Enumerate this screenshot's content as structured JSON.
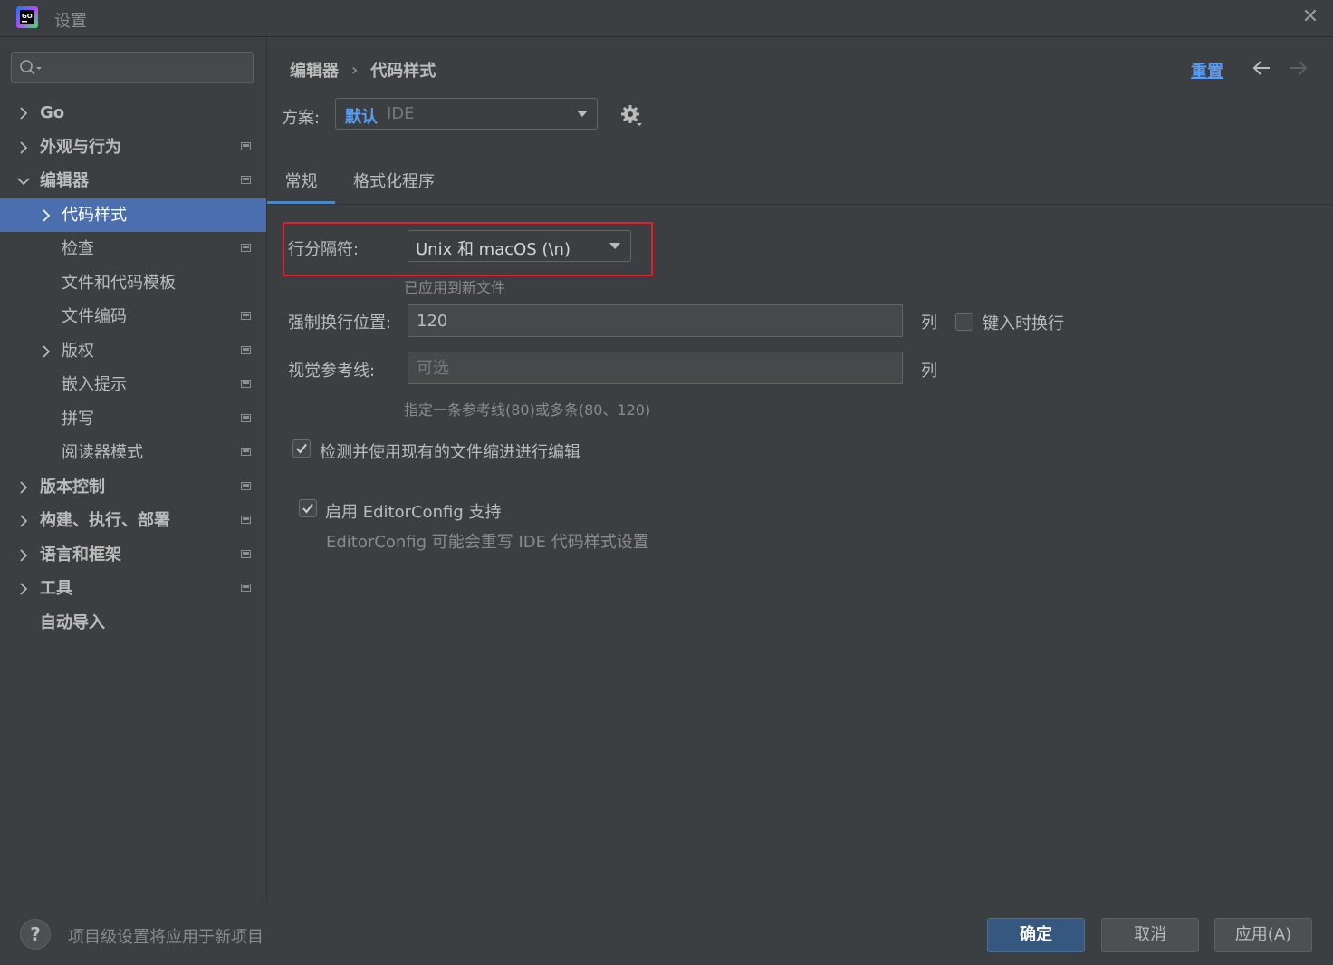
{
  "window": {
    "title": "设置"
  },
  "sidebar": {
    "search_placeholder": "",
    "items": [
      {
        "label": "Go"
      },
      {
        "label": "外观与行为"
      },
      {
        "label": "编辑器"
      },
      {
        "label": "代码样式"
      },
      {
        "label": "检查"
      },
      {
        "label": "文件和代码模板"
      },
      {
        "label": "文件编码"
      },
      {
        "label": "版权"
      },
      {
        "label": "嵌入提示"
      },
      {
        "label": "拼写"
      },
      {
        "label": "阅读器模式"
      },
      {
        "label": "版本控制"
      },
      {
        "label": "构建、执行、部署"
      },
      {
        "label": "语言和框架"
      },
      {
        "label": "工具"
      },
      {
        "label": "自动导入"
      }
    ]
  },
  "header": {
    "breadcrumb": [
      "编辑器",
      "代码样式"
    ],
    "breadcrumb_separator": "›",
    "reset_label": "重置"
  },
  "scheme": {
    "label": "方案:",
    "value_name": "默认",
    "value_type": "IDE"
  },
  "tabs": [
    {
      "label": "常规",
      "active": true
    },
    {
      "label": "格式化程序",
      "active": false
    }
  ],
  "form": {
    "line_separator": {
      "label": "行分隔符:",
      "value": "Unix 和 macOS (\\n)",
      "hint": "已应用到新文件"
    },
    "hard_wrap": {
      "label": "强制换行位置:",
      "value": "120",
      "unit": "列",
      "wrap_on_typing_label": "键入时换行",
      "wrap_on_typing_checked": false
    },
    "visual_guides": {
      "label": "视觉参考线:",
      "placeholder": "可选",
      "unit": "列",
      "hint": "指定一条参考线(80)或多条(80、120)"
    },
    "detect_indent": {
      "label": "检测并使用现有的文件缩进进行编辑",
      "checked": true
    },
    "editorconfig": {
      "label": "启用 EditorConfig 支持",
      "checked": true,
      "hint": "EditorConfig 可能会重写 IDE 代码样式设置"
    }
  },
  "footer": {
    "hint": "项目级设置将应用于新项目",
    "ok_label": "确定",
    "cancel_label": "取消",
    "apply_label": "应用(A)"
  },
  "colors": {
    "background": "#3c3f41",
    "selection": "#4b6eaf",
    "link": "#589df6",
    "primary_button": "#365880",
    "highlight_box": "#e0202d"
  }
}
